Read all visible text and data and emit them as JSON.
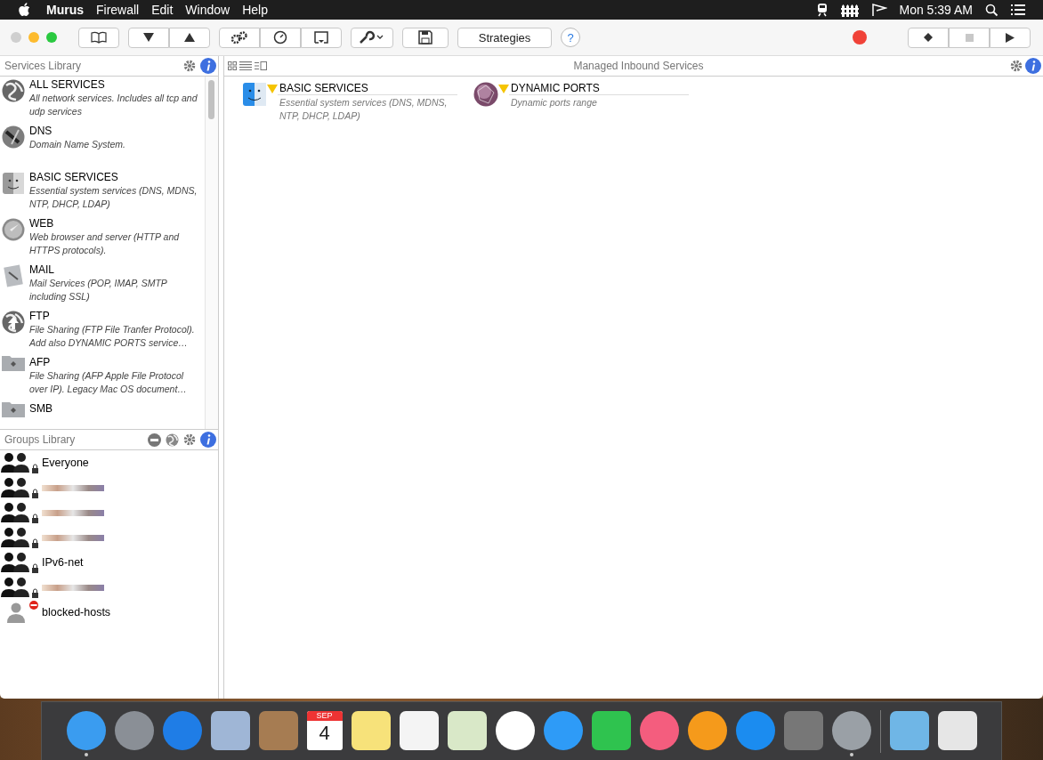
{
  "menu_bar": {
    "app_name": "Murus",
    "menus": [
      "Firewall",
      "Edit",
      "Window",
      "Help"
    ],
    "clock": "Mon 5:39 AM"
  },
  "toolbar": {
    "strategies_label": "Strategies",
    "help_label": "?"
  },
  "services_library": {
    "title": "Services Library",
    "items": [
      {
        "name": "ALL SERVICES",
        "description": "All network services. Includes all tcp and udp services",
        "kind": "globe"
      },
      {
        "name": "DNS",
        "description": "Domain Name System.",
        "kind": "dns"
      },
      {
        "name": "BASIC SERVICES",
        "description": "Essential system services (DNS, MDNS, NTP, DHCP, LDAP)",
        "kind": "finder"
      },
      {
        "name": "WEB",
        "description": "Web browser and server (HTTP and HTTPS protocols).",
        "kind": "compass"
      },
      {
        "name": "MAIL",
        "description": "Mail Services (POP, IMAP, SMTP including SSL)",
        "kind": "mail"
      },
      {
        "name": "FTP",
        "description": "File Sharing (FTP File Tranfer Protocol). Add also DYNAMIC PORTS service…",
        "kind": "upload"
      },
      {
        "name": "AFP",
        "description": "File Sharing  (AFP Apple File Protocol over IP). Legacy Mac OS document…",
        "kind": "folder"
      },
      {
        "name": "SMB",
        "kind": "folder"
      }
    ]
  },
  "groups_library": {
    "title": "Groups Library",
    "items": [
      {
        "name": "Everyone",
        "kind": "group",
        "locked": true,
        "blocked": false,
        "redacted": false
      },
      {
        "kind": "group",
        "locked": true,
        "blocked": false,
        "redacted": true
      },
      {
        "kind": "group",
        "locked": true,
        "blocked": false,
        "redacted": true
      },
      {
        "kind": "group",
        "locked": true,
        "blocked": false,
        "redacted": true
      },
      {
        "name": "IPv6-net",
        "kind": "group",
        "locked": true,
        "blocked": false,
        "redacted": false
      },
      {
        "kind": "group",
        "locked": true,
        "blocked": false,
        "redacted": true
      },
      {
        "name": "blocked-hosts",
        "kind": "user",
        "locked": false,
        "blocked": true,
        "redacted": false
      }
    ]
  },
  "managed": {
    "title": "Managed Inbound Services",
    "items": [
      {
        "name": "BASIC SERVICES",
        "description": "Essential system services (DNS, MDNS, NTP, DHCP, LDAP)",
        "kind": "finder"
      },
      {
        "name": "DYNAMIC PORTS",
        "description": "Dynamic ports range",
        "kind": "sphere"
      }
    ]
  },
  "dock": {
    "items": [
      {
        "kind": "finder",
        "running": true
      },
      {
        "kind": "rocket",
        "running": false
      },
      {
        "kind": "compass",
        "running": false
      },
      {
        "kind": "stamp",
        "running": false
      },
      {
        "kind": "contacts",
        "running": false
      },
      {
        "kind": "calendar",
        "running": false,
        "month": "SEP",
        "day": "4"
      },
      {
        "kind": "notes",
        "running": false
      },
      {
        "kind": "reminders",
        "running": false
      },
      {
        "kind": "maps",
        "running": false
      },
      {
        "kind": "photos",
        "running": false
      },
      {
        "kind": "messages",
        "running": false
      },
      {
        "kind": "facetime",
        "running": false
      },
      {
        "kind": "music",
        "running": false
      },
      {
        "kind": "books",
        "running": false
      },
      {
        "kind": "appstore",
        "running": false
      },
      {
        "kind": "gear",
        "running": false
      },
      {
        "kind": "castle",
        "running": true
      },
      {
        "kind": "downloads",
        "running": false
      },
      {
        "kind": "trash",
        "running": false
      }
    ]
  }
}
